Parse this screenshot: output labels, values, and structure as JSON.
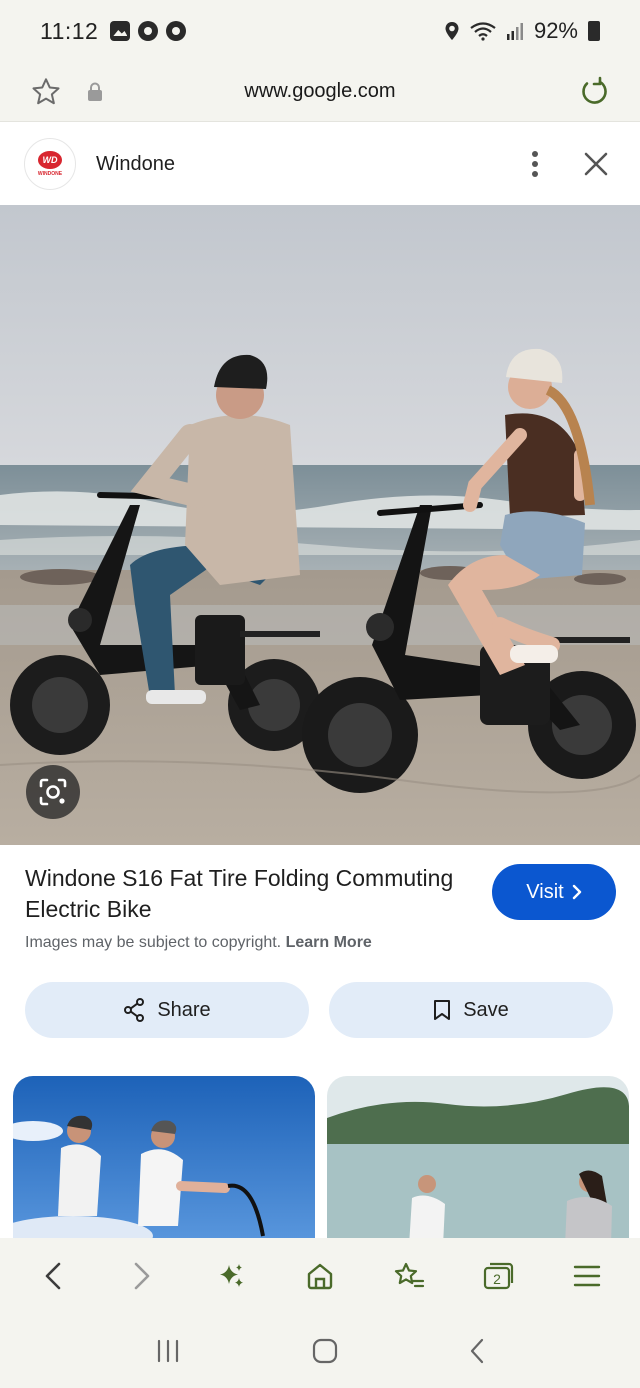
{
  "status_bar": {
    "time": "11:12",
    "battery": "92%"
  },
  "browser": {
    "url": "www.google.com"
  },
  "sheet": {
    "site_name": "Windone",
    "logo_mark": "WD",
    "logo_word": "WINDONE"
  },
  "result": {
    "title": "Windone S16 Fat Tire Folding Commuting Electric Bike",
    "visit_label": "Visit",
    "copyright_text": "Images may be subject to copyright.",
    "learn_more": "Learn More",
    "share_label": "Share",
    "save_label": "Save"
  },
  "toolbar": {
    "tab_count": "2"
  },
  "colors": {
    "accent": "#0b57d0",
    "pill_bg": "#e2ecf8",
    "chrome_bg": "#f4f4ef",
    "icon_green": "#4a6a2a"
  }
}
